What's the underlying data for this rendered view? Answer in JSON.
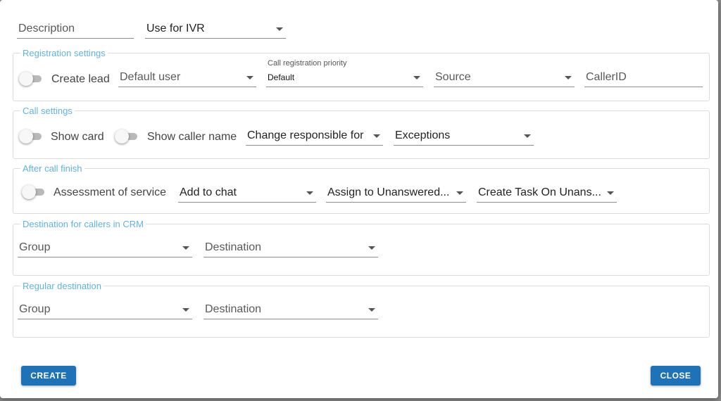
{
  "header": {
    "description_placeholder": "Description",
    "use_for_ivr_label": "Use for IVR"
  },
  "registration": {
    "legend": "Registration settings",
    "create_lead_label": "Create lead",
    "create_lead_on": false,
    "default_user_label": "Default user",
    "priority_label": "Call registration priority",
    "priority_value": "Default",
    "source_label": "Source",
    "callerid_placeholder": "CallerID"
  },
  "call_settings": {
    "legend": "Call settings",
    "show_card_label": "Show card",
    "show_card_on": false,
    "show_caller_name_label": "Show caller name",
    "show_caller_name_on": false,
    "change_responsible_label": "Change responsible for",
    "exceptions_label": "Exceptions"
  },
  "after_call": {
    "legend": "After call finish",
    "assessment_label": "Assessment of service",
    "assessment_on": false,
    "add_to_chat_label": "Add to chat",
    "assign_unanswered_label": "Assign to Unanswered...",
    "create_task_label": "Create Task On Unans..."
  },
  "crm_destination": {
    "legend": "Destination for callers in CRM",
    "group_label": "Group",
    "destination_label": "Destination"
  },
  "regular_destination": {
    "legend": "Regular destination",
    "group_label": "Group",
    "destination_label": "Destination"
  },
  "buttons": {
    "create": "CREATE",
    "close": "CLOSE"
  },
  "colors": {
    "accent": "#1d72b8",
    "legend": "#5fb3e0"
  }
}
